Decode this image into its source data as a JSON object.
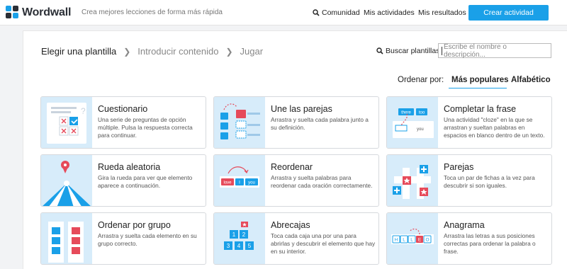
{
  "header": {
    "logo_text": "Wordwall",
    "tagline": "Crea mejores lecciones de forma más rápida",
    "nav": [
      {
        "label": "Comunidad",
        "icon": "search-icon"
      },
      {
        "label": "Mis actividades"
      },
      {
        "label": "Mis resultados"
      }
    ],
    "create_label": "Crear actividad",
    "colors": {
      "accent": "#1aa0e8"
    }
  },
  "breadcrumb": {
    "steps": [
      "Elegir una plantilla",
      "Introducir contenido",
      "Jugar"
    ]
  },
  "search": {
    "label": "Buscar plantillas:",
    "placeholder": "Escribe el nombre o descripción..."
  },
  "sort": {
    "label": "Ordenar por:",
    "options": [
      "Más populares",
      "Alfabético"
    ],
    "selected": "Más populares"
  },
  "templates": [
    {
      "title": "Cuestionario",
      "desc": "Una serie de preguntas de opción múltiple. Pulsa la respuesta correcta para continuar."
    },
    {
      "title": "Une las parejas",
      "desc": "Arrastra y suelta cada palabra junto a su definición."
    },
    {
      "title": "Completar la frase",
      "desc": "Una actividad \"cloze\" en la que se arrastran y sueltan palabras en espacios en blanco dentro de un texto."
    },
    {
      "title": "Rueda aleatoria",
      "desc": "Gira la rueda para ver que elemento aparece a continuación."
    },
    {
      "title": "Reordenar",
      "desc": "Arrastra y suelta palabras para reordenar cada oración correctamente."
    },
    {
      "title": "Parejas",
      "desc": "Toca un par de fichas a la vez para descubrir si son iguales."
    },
    {
      "title": "Ordenar por grupo",
      "desc": "Arrastra y suelta cada elemento en su grupo correcto."
    },
    {
      "title": "Abrecajas",
      "desc": "Toca cada caja una por una para abrirlas y descubrir el elemento que hay en su interior."
    },
    {
      "title": "Anagrama",
      "desc": "Arrastra las letras a sus posiciones correctas para ordenar la palabra o frase."
    }
  ],
  "thumb_text": {
    "une_words": [
      "there",
      "too",
      "you"
    ],
    "reordenar_words": [
      "love",
      "I",
      "you"
    ],
    "abrecajas_numbers": [
      "1",
      "2",
      "3",
      "4",
      "5"
    ],
    "anagrama_letters": [
      "H",
      "L",
      "L",
      "E",
      "O"
    ]
  }
}
